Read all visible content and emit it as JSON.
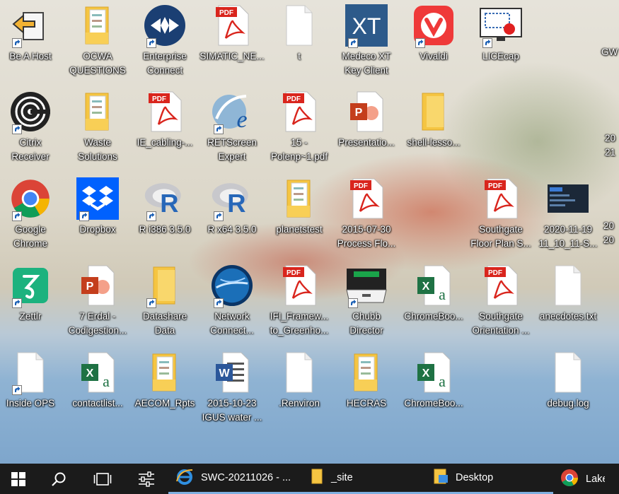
{
  "desktop": {
    "icons": [
      {
        "label": "Be A Host",
        "icon": "arrow-back-icon"
      },
      {
        "label": "OCWA\nQUESTIONS",
        "icon": "folder-docs-icon"
      },
      {
        "label": "Enterprise\nConnect",
        "icon": "enterprise-connect-icon"
      },
      {
        "label": "SIMATIC_NE...",
        "icon": "pdf-icon"
      },
      {
        "label": "t",
        "icon": "blank-file-icon"
      },
      {
        "label": "Medeco XT\nKey Client",
        "icon": "medeco-xt-icon"
      },
      {
        "label": "Vivaldi",
        "icon": "vivaldi-icon"
      },
      {
        "label": "LICEcap",
        "icon": "licecap-icon"
      },
      {
        "label": "Citrix\nReceiver",
        "icon": "citrix-icon"
      },
      {
        "label": "Waste\nSolutions",
        "icon": "folder-docs-icon"
      },
      {
        "label": "IE_cabling-...",
        "icon": "pdf-icon"
      },
      {
        "label": "RETScreen\nExpert",
        "icon": "retscreen-icon"
      },
      {
        "label": "15 -\nPolenp~1.pdf",
        "icon": "pdf-icon"
      },
      {
        "label": "Presentatio...",
        "icon": "powerpoint-icon"
      },
      {
        "label": "shell-lesso...",
        "icon": "folder-icon"
      },
      {
        "label": "Google\nChrome",
        "icon": "chrome-icon"
      },
      {
        "label": "Dropbox",
        "icon": "dropbox-icon"
      },
      {
        "label": "R i386 3.5.0",
        "icon": "r-icon"
      },
      {
        "label": "R x64 3.5.0",
        "icon": "r-icon"
      },
      {
        "label": "planetstest",
        "icon": "folder-docs-icon"
      },
      {
        "label": "2015-07-30\nProcess Flo...",
        "icon": "pdf-icon"
      },
      {
        "label": "Southgate\nFloor Plan S...",
        "icon": "pdf-icon"
      },
      {
        "label": "2020-11-19\n11_10_11-S...",
        "icon": "screenshot-image-icon"
      },
      {
        "label": "Zettlr",
        "icon": "zettlr-icon"
      },
      {
        "label": "7 Erdal -\nCodigestion...",
        "icon": "powerpoint-icon"
      },
      {
        "label": "Datashare\nData",
        "icon": "folder-icon"
      },
      {
        "label": "Network\nConnect...",
        "icon": "network-connect-icon"
      },
      {
        "label": "IFI_Framew...\nto_Greenho...",
        "icon": "pdf-icon"
      },
      {
        "label": "Chubb\nDirector",
        "icon": "chubb-director-icon"
      },
      {
        "label": "ChromeBoo...",
        "icon": "excel-icon"
      },
      {
        "label": "Southgate\nOrientation ...",
        "icon": "pdf-icon"
      },
      {
        "label": "anecdotes.txt",
        "icon": "blank-file-icon"
      },
      {
        "label": "Inside OPS",
        "icon": "blank-file-icon"
      },
      {
        "label": "contactlist...",
        "icon": "excel-icon"
      },
      {
        "label": "AECOM_Rpts",
        "icon": "folder-docs-icon"
      },
      {
        "label": "2015-10-23\nIGUS water ...",
        "icon": "word-icon"
      },
      {
        "label": ".Renviron",
        "icon": "blank-file-icon"
      },
      {
        "label": "HECRAS",
        "icon": "folder-docs-icon"
      },
      {
        "label": "ChromeBoo...",
        "icon": "excel-icon"
      },
      {
        "label": "debug.log",
        "icon": "blank-file-icon"
      }
    ],
    "partial_labels": [
      "GW",
      "20\n21",
      "20\n20"
    ]
  },
  "taskbar": {
    "start_icon": "windows-start-icon",
    "search_icon": "search-icon",
    "task_view_icon": "task-view-icon",
    "settings_icon": "sliders-icon",
    "apps": [
      {
        "label": "SWC-20211026 - ...",
        "icon": "internet-explorer-icon"
      },
      {
        "label": "_site",
        "icon": "folder-icon"
      },
      {
        "label": "Desktop",
        "icon": "folder-icon"
      },
      {
        "label": "Lake C",
        "icon": "chrome-icon"
      }
    ]
  },
  "colors": {
    "taskbar_bg": "#1b1b1b",
    "pdf_red": "#d9251d",
    "folder_yellow": "#f5c542",
    "excel_green": "#1f7244"
  }
}
